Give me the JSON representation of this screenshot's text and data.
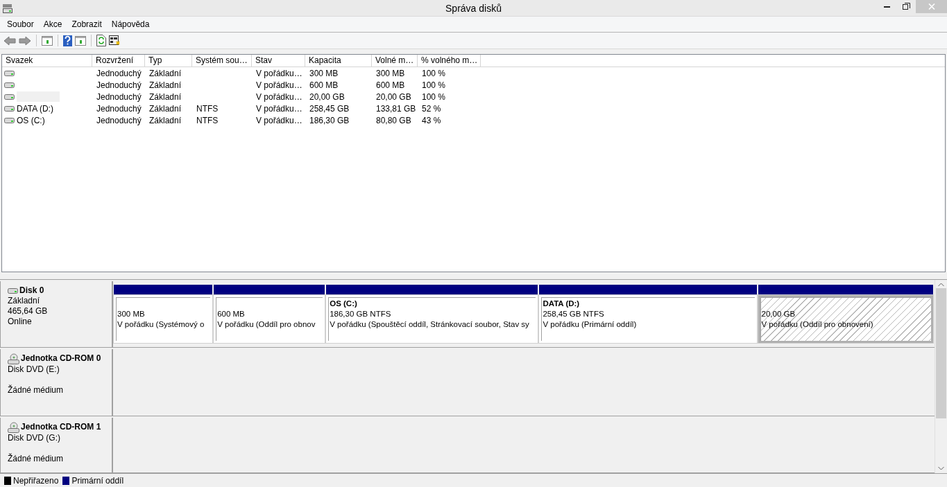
{
  "window": {
    "title": "Správa disků"
  },
  "menu": [
    "Soubor",
    "Akce",
    "Zobrazit",
    "Nápověda"
  ],
  "table": {
    "columns": [
      "Svazek",
      "Rozvržení",
      "Typ",
      "Systém sou…",
      "Stav",
      "Kapacita",
      "Volné m…",
      "% volného m…"
    ],
    "rows": [
      {
        "name_masked": false,
        "layout": "Jednoduchý",
        "type": "Základní",
        "status": "V pořádku…",
        "capacity": "300 MB",
        "free": "300 MB",
        "free_percent": "100 %"
      },
      {
        "name_masked": false,
        "layout": "Jednoduchý",
        "type": "Základní",
        "status": "V pořádku…",
        "capacity": "600 MB",
        "free": "600 MB",
        "free_percent": "100 %"
      },
      {
        "name_masked": true,
        "layout": "Jednoduchý",
        "type": "Základní",
        "status": "V pořádku…",
        "capacity": "20,00 GB",
        "free": "20,00 GB",
        "free_percent": "100 %"
      },
      {
        "name_masked": false,
        "volume": "DATA (D:)",
        "layout": "Jednoduchý",
        "type": "Základní",
        "file_system": "NTFS",
        "status": "V pořádku…",
        "capacity": "258,45 GB",
        "free": "133,81 GB",
        "free_percent": "52 %"
      },
      {
        "name_masked": false,
        "volume": "OS (C:)",
        "layout": "Jednoduchý",
        "type": "Základní",
        "file_system": "NTFS",
        "status": "V pořádku…",
        "capacity": "186,30 GB",
        "free": "80,80 GB",
        "free_percent": "43 %"
      }
    ]
  },
  "disks": [
    {
      "kind": "disk",
      "name": "Disk 0",
      "lines": [
        "Základní",
        "465,64 GB",
        "Online"
      ],
      "partitions": [
        {
          "selected": false,
          "size": "300 MB",
          "status": "V pořádku (Systémový o"
        },
        {
          "selected": false,
          "size": "600 MB",
          "status": "V pořádku (Oddíl pro obnov"
        },
        {
          "selected": false,
          "title": "OS  (C:)",
          "size": "186,30 GB NTFS",
          "status": "V pořádku (Spouštěcí oddíl, Stránkovací soubor, Stav sy"
        },
        {
          "selected": false,
          "title": "DATA  (D:)",
          "size": "258,45 GB NTFS",
          "status": "V pořádku (Primární oddíl)"
        },
        {
          "selected": true,
          "size": "20,00 GB",
          "status": "V pořádku (Oddíl pro obnovení)"
        }
      ]
    },
    {
      "kind": "cdrom",
      "name": "Jednotka CD-ROM 0",
      "lines": [
        "Disk DVD (E:)",
        "Žádné médium"
      ]
    },
    {
      "kind": "cdrom",
      "name": "Jednotka CD-ROM 1",
      "lines": [
        "Disk DVD (G:)",
        "Žádné médium"
      ]
    }
  ],
  "legend": [
    {
      "label": "Nepřiřazeno",
      "color": "#000000"
    },
    {
      "label": "Primární oddíl",
      "color": "#000080"
    }
  ]
}
